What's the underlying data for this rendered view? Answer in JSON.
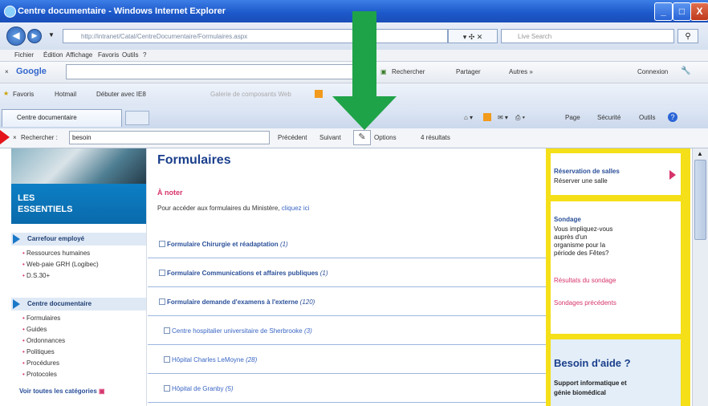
{
  "window": {
    "title": "Centre documentaire - Windows Internet Explorer",
    "controls": [
      "_",
      "□",
      "X"
    ]
  },
  "address": {
    "url": "http://intranet/Catal/CentreDocumentaire/Formulaires.aspx",
    "live_search_placeholder": "Live Search"
  },
  "menu": [
    "Fichier",
    "Édition",
    "Affichage",
    "Favoris",
    "Outils",
    "?"
  ],
  "google_toolbar": {
    "logo": "Google",
    "search_label": "Rechercher",
    "share_label": "Partager",
    "more_label": "Autres »",
    "signin_label": "Connexion"
  },
  "favorites_bar": {
    "favorites_label": "Favoris",
    "items": [
      "Hotmail",
      "Débuter avec IE8",
      "Galerie de composants Web"
    ]
  },
  "tab": {
    "title": "Centre documentaire"
  },
  "command_bar": {
    "page_label": "Page",
    "safety_label": "Sécurité",
    "tools_label": "Outils"
  },
  "find_bar": {
    "label": "Rechercher :",
    "query": "besoin",
    "previous_label": "Précédent",
    "next_label": "Suivant",
    "options_label": "Options",
    "results": "4 résultats"
  },
  "left": {
    "essentiels_line1": "LES",
    "essentiels_line2": "ESSENTIELS",
    "sections": [
      {
        "title": "Carrefour employé",
        "items": [
          "Ressources humaines",
          "Web-paie GRH (Logibec)",
          "D.S.30+"
        ]
      },
      {
        "title": "Centre documentaire",
        "items": [
          "Formulaires",
          "Guides",
          "Ordonnances",
          "Politiques",
          "Procédures",
          "Protocoles"
        ]
      }
    ],
    "see_all": "Voir toutes les catégories"
  },
  "main": {
    "title": "Formulaires",
    "note_title": "À noter",
    "note_text": "Pour accéder aux formulaires du Ministère,",
    "note_link": "cliquez ici",
    "rows": [
      {
        "label": "Formulaire Chirurgie et réadaptation",
        "count": "(1)",
        "sub": false
      },
      {
        "label": "Formulaire Communications et affaires publiques",
        "count": "(1)",
        "sub": false
      },
      {
        "label": "Formulaire demande d'examens à l'externe",
        "count": "(120)",
        "sub": false
      },
      {
        "label": "Centre hospitalier universitaire de Sherbrooke",
        "count": "(3)",
        "sub": true
      },
      {
        "label": "Hôpital Charles LeMoyne",
        "count": "(28)",
        "sub": true
      },
      {
        "label": "Hôpital de Granby",
        "count": "(5)",
        "sub": true
      }
    ]
  },
  "right": {
    "reservation_title": "Réservation de salles",
    "reservation_text": "Réserver une salle",
    "sondage_title": "Sondage",
    "sondage_text": [
      "Vous impliquez-vous",
      "auprès d'un",
      "organisme pour la",
      "période des Fêtes?"
    ],
    "sondage_results": "Résultats du sondage",
    "sondage_previous": "Sondages précédents",
    "help_title": "Besoin d'aide ?",
    "help_text": [
      "Support informatique et",
      "génie biomédical"
    ]
  },
  "colors": {
    "marker_red": "#e3151b",
    "arrow_green": "#1fa348",
    "title_blue": "#1b3f8c",
    "accent_pink": "#d6336c",
    "right_yellow": "#f5df18"
  }
}
